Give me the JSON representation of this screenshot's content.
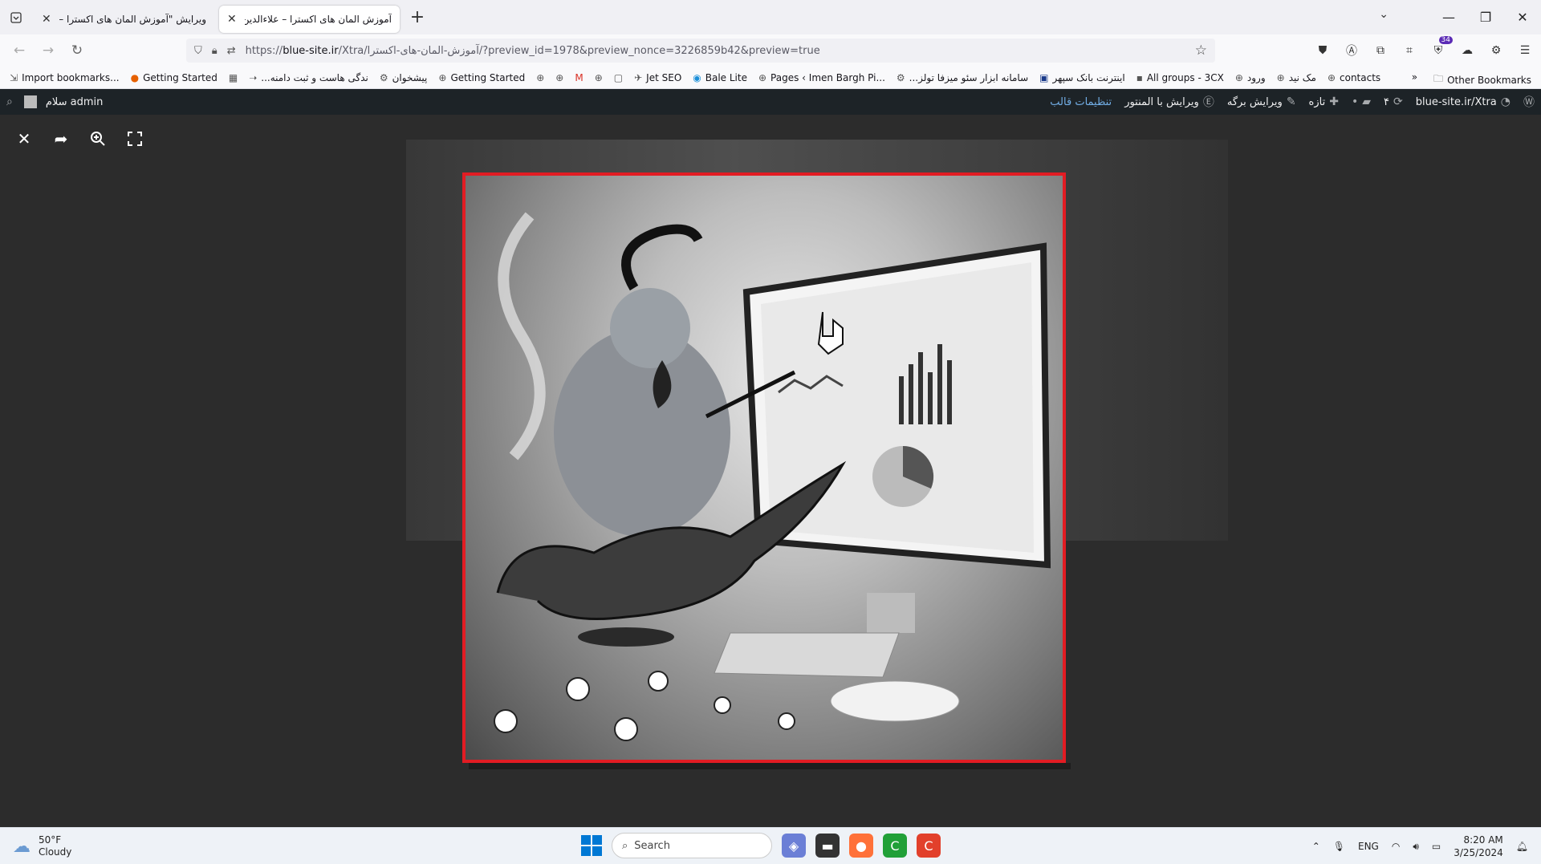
{
  "tabs": [
    {
      "label": "ویرایش \"آموزش المان های اکسترا – علاءالدین",
      "active": false
    },
    {
      "label": "آموزش المان های اکسترا – علاءالدین",
      "active": true
    }
  ],
  "window": {
    "minimize": "—",
    "restore": "❐",
    "close": "✕"
  },
  "nav": {
    "url_prefix": "https://",
    "url_host": "blue-site.ir",
    "url_path": "/Xtra/آموزش-المان-های-اکسترا/?preview_id=1978&preview_nonce=3226859b42&preview=true",
    "extension_badge": "34"
  },
  "bookmarks": [
    {
      "label": "Import bookmarks...",
      "icon": "import-icon"
    },
    {
      "label": "Getting Started",
      "icon": "firefox-icon"
    },
    {
      "label": "",
      "icon": "calendar-icon"
    },
    {
      "label": "...ندگی هاست و ثبت دامنه",
      "icon": "arrow-icon"
    },
    {
      "label": "پیشخوان",
      "icon": "gear-icon"
    },
    {
      "label": "Getting Started",
      "icon": "globe-icon"
    },
    {
      "label": "",
      "icon": "globe-icon"
    },
    {
      "label": "",
      "icon": "globe-icon"
    },
    {
      "label": "",
      "icon": "gmail-icon"
    },
    {
      "label": "",
      "icon": "globe-icon"
    },
    {
      "label": "",
      "icon": "bookmark-icon"
    },
    {
      "label": "Jet SEO",
      "icon": "jet-icon"
    },
    {
      "label": "Bale Lite",
      "icon": "bale-icon"
    },
    {
      "label": "Pages ‹ Imen Bargh Pi...",
      "icon": "globe-icon"
    },
    {
      "label": "...سامانه ابزار سئو میزفا تولز",
      "icon": "gear-icon"
    },
    {
      "label": "اینترنت بانک سپهر",
      "icon": "bank-icon"
    },
    {
      "label": "All groups - 3CX",
      "icon": "3cx-icon"
    },
    {
      "label": "ورود",
      "icon": "globe-icon"
    },
    {
      "label": "مک نید",
      "icon": "globe-icon"
    },
    {
      "label": "contacts",
      "icon": "globe-icon"
    }
  ],
  "bookmarks_other": "Other Bookmarks",
  "adminbar": {
    "greeting": "سلام admin",
    "site": "blue-site.ir/Xtra",
    "updates": "۴",
    "new": "تازه",
    "edit_page": "ویرایش برگه",
    "elementor": "ویرایش با المنتور",
    "theme_settings": "تنظیمات قالب"
  },
  "taskbar": {
    "temp": "50°F",
    "condition": "Cloudy",
    "search_placeholder": "Search",
    "lang": "ENG",
    "time": "8:20 AM",
    "date": "3/25/2024"
  },
  "colors": {
    "accent_border": "#e21c23",
    "admin_bar": "#1d2327",
    "admin_link": "#72aee6"
  }
}
